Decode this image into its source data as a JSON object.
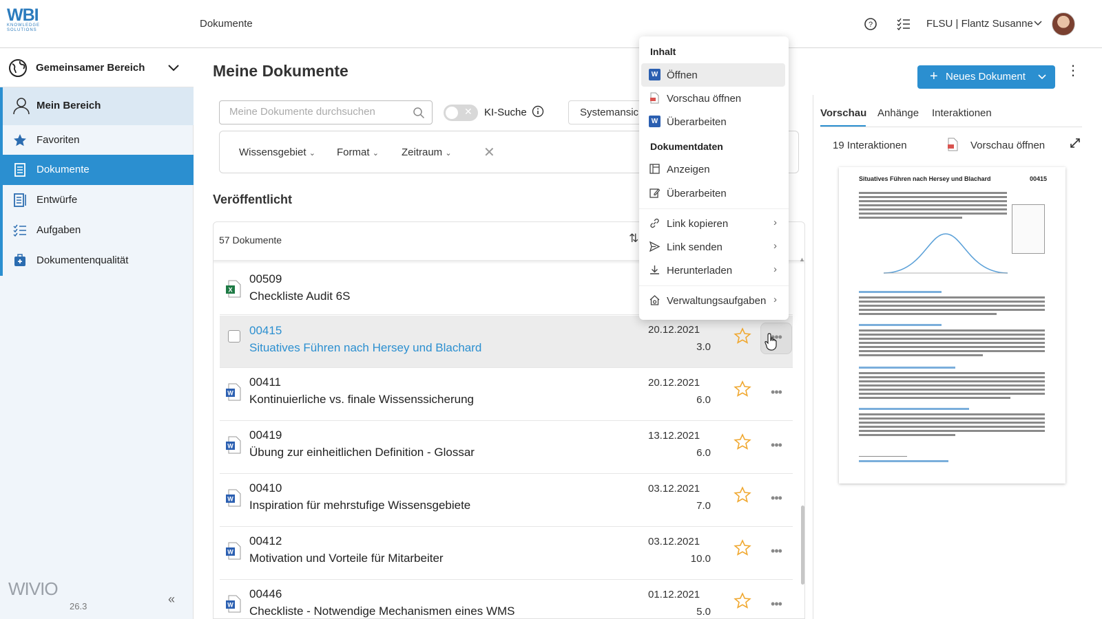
{
  "header": {
    "logo_text": "WBI",
    "logo_sub": "KNOWLEDGE SOLUTIONS",
    "title": "Dokumente",
    "user": "FLSU | Flantz Susanne"
  },
  "sidebar": {
    "area": "Gemeinsamer Bereich",
    "mine": "Mein Bereich",
    "items": [
      {
        "label": "Favoriten"
      },
      {
        "label": "Dokumente"
      },
      {
        "label": "Entwürfe"
      },
      {
        "label": "Aufgaben"
      },
      {
        "label": "Dokumentenqualität"
      }
    ],
    "brand": "WIVIO",
    "version": "26.3"
  },
  "main": {
    "title": "Meine Dokumente",
    "search_placeholder": "Meine Dokumente durchsuchen",
    "ki_label": "KI-Suche",
    "system_view": "Systemansicht",
    "filters": [
      "Wissensgebiet",
      "Format",
      "Zeitraum"
    ],
    "section": "Veröffentlicht",
    "count": "57 Dokumente",
    "new_doc": "Neues Dokument"
  },
  "rows": [
    {
      "num": "00509",
      "name": "Checkliste Audit 6S",
      "date": "",
      "ver": "",
      "type": "excel"
    },
    {
      "num": "00415",
      "name": "Situatives Führen nach Hersey und Blachard",
      "date": "20.12.2021",
      "ver": "3.0",
      "type": "word"
    },
    {
      "num": "00411",
      "name": "Kontinuierliche vs. finale Wissenssicherung",
      "date": "20.12.2021",
      "ver": "6.0",
      "type": "word"
    },
    {
      "num": "00419",
      "name": "Übung zur einheitlichen Definition - Glossar",
      "date": "13.12.2021",
      "ver": "6.0",
      "type": "word"
    },
    {
      "num": "00410",
      "name": "Inspiration für mehrstufige Wissensgebiete",
      "date": "03.12.2021",
      "ver": "7.0",
      "type": "word"
    },
    {
      "num": "00412",
      "name": "Motivation und Vorteile für Mitarbeiter",
      "date": "03.12.2021",
      "ver": "10.0",
      "type": "word"
    },
    {
      "num": "00446",
      "name": "Checkliste - Notwendige Mechanismen eines WMS",
      "date": "01.12.2021",
      "ver": "5.0",
      "type": "word"
    }
  ],
  "preview": {
    "tabs": [
      "Vorschau",
      "Anhänge",
      "Interaktionen"
    ],
    "interactions": "19 Interaktionen",
    "open_preview": "Vorschau öffnen",
    "doc_title": "Situatives Führen nach Hersey und Blachard",
    "doc_num": "00415"
  },
  "menu": {
    "section_content": "Inhalt",
    "open": "Öffnen",
    "open_preview": "Vorschau öffnen",
    "edit": "Überarbeiten",
    "section_data": "Dokumentdaten",
    "show": "Anzeigen",
    "edit_data": "Überarbeiten",
    "copy_link": "Link kopieren",
    "send_link": "Link senden",
    "download": "Herunterladen",
    "admin": "Verwaltungsaufgaben"
  },
  "colors": {
    "accent": "#2b8fd0",
    "star": "#f0a830"
  }
}
